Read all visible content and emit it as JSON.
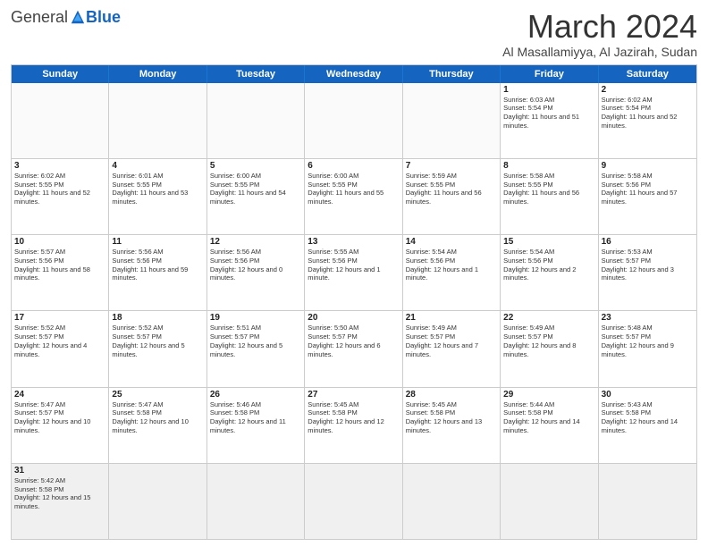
{
  "header": {
    "logo_general": "General",
    "logo_blue": "Blue",
    "month_title": "March 2024",
    "location": "Al Masallamiyya, Al Jazirah, Sudan"
  },
  "days_of_week": [
    "Sunday",
    "Monday",
    "Tuesday",
    "Wednesday",
    "Thursday",
    "Friday",
    "Saturday"
  ],
  "weeks": [
    {
      "cells": [
        {
          "day": "",
          "info": ""
        },
        {
          "day": "",
          "info": ""
        },
        {
          "day": "",
          "info": ""
        },
        {
          "day": "",
          "info": ""
        },
        {
          "day": "",
          "info": ""
        },
        {
          "day": "1",
          "info": "Sunrise: 6:03 AM\nSunset: 5:54 PM\nDaylight: 11 hours and 51 minutes."
        },
        {
          "day": "2",
          "info": "Sunrise: 6:02 AM\nSunset: 5:54 PM\nDaylight: 11 hours and 52 minutes."
        }
      ]
    },
    {
      "cells": [
        {
          "day": "3",
          "info": "Sunrise: 6:02 AM\nSunset: 5:55 PM\nDaylight: 11 hours and 52 minutes."
        },
        {
          "day": "4",
          "info": "Sunrise: 6:01 AM\nSunset: 5:55 PM\nDaylight: 11 hours and 53 minutes."
        },
        {
          "day": "5",
          "info": "Sunrise: 6:00 AM\nSunset: 5:55 PM\nDaylight: 11 hours and 54 minutes."
        },
        {
          "day": "6",
          "info": "Sunrise: 6:00 AM\nSunset: 5:55 PM\nDaylight: 11 hours and 55 minutes."
        },
        {
          "day": "7",
          "info": "Sunrise: 5:59 AM\nSunset: 5:55 PM\nDaylight: 11 hours and 56 minutes."
        },
        {
          "day": "8",
          "info": "Sunrise: 5:58 AM\nSunset: 5:55 PM\nDaylight: 11 hours and 56 minutes."
        },
        {
          "day": "9",
          "info": "Sunrise: 5:58 AM\nSunset: 5:56 PM\nDaylight: 11 hours and 57 minutes."
        }
      ]
    },
    {
      "cells": [
        {
          "day": "10",
          "info": "Sunrise: 5:57 AM\nSunset: 5:56 PM\nDaylight: 11 hours and 58 minutes."
        },
        {
          "day": "11",
          "info": "Sunrise: 5:56 AM\nSunset: 5:56 PM\nDaylight: 11 hours and 59 minutes."
        },
        {
          "day": "12",
          "info": "Sunrise: 5:56 AM\nSunset: 5:56 PM\nDaylight: 12 hours and 0 minutes."
        },
        {
          "day": "13",
          "info": "Sunrise: 5:55 AM\nSunset: 5:56 PM\nDaylight: 12 hours and 1 minute."
        },
        {
          "day": "14",
          "info": "Sunrise: 5:54 AM\nSunset: 5:56 PM\nDaylight: 12 hours and 1 minute."
        },
        {
          "day": "15",
          "info": "Sunrise: 5:54 AM\nSunset: 5:56 PM\nDaylight: 12 hours and 2 minutes."
        },
        {
          "day": "16",
          "info": "Sunrise: 5:53 AM\nSunset: 5:57 PM\nDaylight: 12 hours and 3 minutes."
        }
      ]
    },
    {
      "cells": [
        {
          "day": "17",
          "info": "Sunrise: 5:52 AM\nSunset: 5:57 PM\nDaylight: 12 hours and 4 minutes."
        },
        {
          "day": "18",
          "info": "Sunrise: 5:52 AM\nSunset: 5:57 PM\nDaylight: 12 hours and 5 minutes."
        },
        {
          "day": "19",
          "info": "Sunrise: 5:51 AM\nSunset: 5:57 PM\nDaylight: 12 hours and 5 minutes."
        },
        {
          "day": "20",
          "info": "Sunrise: 5:50 AM\nSunset: 5:57 PM\nDaylight: 12 hours and 6 minutes."
        },
        {
          "day": "21",
          "info": "Sunrise: 5:49 AM\nSunset: 5:57 PM\nDaylight: 12 hours and 7 minutes."
        },
        {
          "day": "22",
          "info": "Sunrise: 5:49 AM\nSunset: 5:57 PM\nDaylight: 12 hours and 8 minutes."
        },
        {
          "day": "23",
          "info": "Sunrise: 5:48 AM\nSunset: 5:57 PM\nDaylight: 12 hours and 9 minutes."
        }
      ]
    },
    {
      "cells": [
        {
          "day": "24",
          "info": "Sunrise: 5:47 AM\nSunset: 5:57 PM\nDaylight: 12 hours and 10 minutes."
        },
        {
          "day": "25",
          "info": "Sunrise: 5:47 AM\nSunset: 5:58 PM\nDaylight: 12 hours and 10 minutes."
        },
        {
          "day": "26",
          "info": "Sunrise: 5:46 AM\nSunset: 5:58 PM\nDaylight: 12 hours and 11 minutes."
        },
        {
          "day": "27",
          "info": "Sunrise: 5:45 AM\nSunset: 5:58 PM\nDaylight: 12 hours and 12 minutes."
        },
        {
          "day": "28",
          "info": "Sunrise: 5:45 AM\nSunset: 5:58 PM\nDaylight: 12 hours and 13 minutes."
        },
        {
          "day": "29",
          "info": "Sunrise: 5:44 AM\nSunset: 5:58 PM\nDaylight: 12 hours and 14 minutes."
        },
        {
          "day": "30",
          "info": "Sunrise: 5:43 AM\nSunset: 5:58 PM\nDaylight: 12 hours and 14 minutes."
        }
      ]
    },
    {
      "cells": [
        {
          "day": "31",
          "info": "Sunrise: 5:42 AM\nSunset: 5:58 PM\nDaylight: 12 hours and 15 minutes."
        },
        {
          "day": "",
          "info": ""
        },
        {
          "day": "",
          "info": ""
        },
        {
          "day": "",
          "info": ""
        },
        {
          "day": "",
          "info": ""
        },
        {
          "day": "",
          "info": ""
        },
        {
          "day": "",
          "info": ""
        }
      ]
    }
  ]
}
